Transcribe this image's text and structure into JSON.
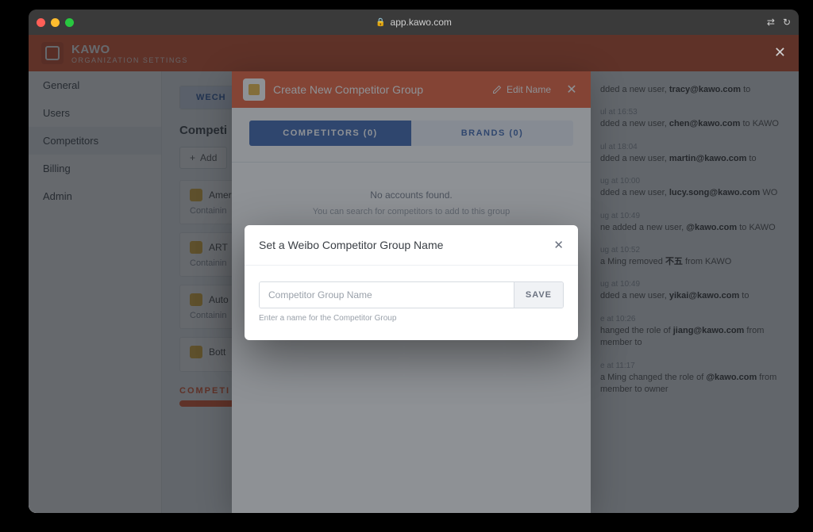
{
  "browser": {
    "url": "app.kawo.com"
  },
  "app": {
    "brand": "KAWO",
    "subtitle": "ORGANIZATION SETTINGS",
    "sidebar": {
      "items": [
        {
          "label": "General"
        },
        {
          "label": "Users"
        },
        {
          "label": "Competitors"
        },
        {
          "label": "Billing"
        },
        {
          "label": "Admin"
        }
      ]
    },
    "filter_tab_active": "WECH",
    "section_title": "Competi",
    "add_label": "Add",
    "groups": [
      {
        "name": "Amer",
        "sub": "Containin"
      },
      {
        "name": "ART ",
        "sub": "Containin"
      },
      {
        "name": "Auto",
        "sub": "Containin"
      },
      {
        "name": "Bott",
        "sub": ""
      }
    ],
    "footer_label": "COMPETI"
  },
  "activity": {
    "items": [
      {
        "time": "",
        "text_before": "dded a new user, ",
        "bold": "tracy@kawo.com",
        "text_after": " to "
      },
      {
        "time": "ul at 16:53",
        "text_before": "dded a new user, ",
        "bold": "chen@kawo.com",
        "text_after": " to KAWO"
      },
      {
        "time": "ul at 18:04",
        "text_before": "dded a new user, ",
        "bold": "martin@kawo.com",
        "text_after": " to "
      },
      {
        "time": "ug at 10:00",
        "text_before": "dded a new user, ",
        "bold": "lucy.song@kawo.com",
        "text_after": " WO"
      },
      {
        "time": "ug at 10:49",
        "text_before": "ne added a new user, ",
        "bold": "@kawo.com",
        "text_after": " to KAWO"
      },
      {
        "time": "ug at 10:52",
        "text_before": "a Ming removed ",
        "bold": "不五",
        "text_after": " from KAWO"
      },
      {
        "time": "ug at 10:49",
        "text_before": "dded a new user, ",
        "bold": "yikai@kawo.com",
        "text_after": " to "
      },
      {
        "time": "e at 10:26",
        "text_before": "hanged the role of ",
        "bold": "jiang@kawo.com",
        "text_after": " from member to "
      },
      {
        "time": "e at 11:17",
        "text_before": "a Ming changed the role of ",
        "bold": "@kawo.com",
        "text_after": " from member to owner"
      }
    ]
  },
  "modal1": {
    "title": "Create New Competitor Group",
    "edit_label": "Edit Name",
    "tabs": [
      {
        "label": "COMPETITORS (0)"
      },
      {
        "label": "BRANDS (0)"
      }
    ],
    "empty_title": "No accounts found.",
    "empty_sub": "You can search for competitors to add to this group"
  },
  "modal2": {
    "title": "Set a Weibo Competitor Group Name",
    "placeholder": "Competitor Group Name",
    "save_label": "SAVE",
    "hint": "Enter a name for the Competitor Group"
  }
}
